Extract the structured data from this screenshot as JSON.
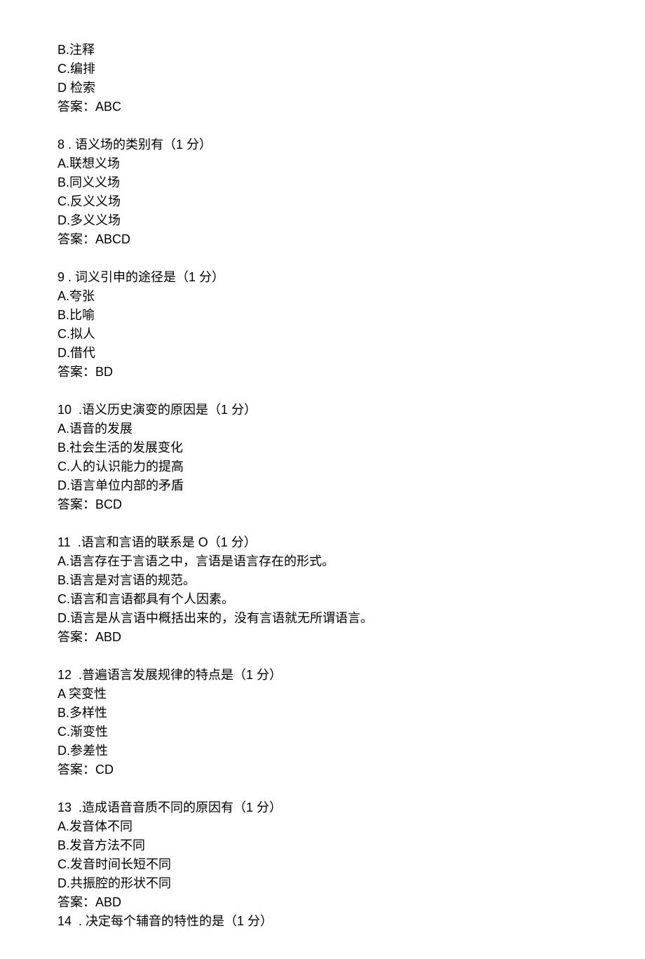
{
  "initial_options": [
    "B.注释",
    "C.编排",
    "D 检索"
  ],
  "initial_answer": "答案：ABC",
  "questions": [
    {
      "number": "8",
      "stem": " . 语义场的类别有（1 分）",
      "options": [
        "A.联想义场",
        "B.同义义场",
        "C.反义义场",
        "D.多义义场"
      ],
      "answer": "答案：ABCD"
    },
    {
      "number": "9",
      "stem": " . 词义引申的途径是（1 分）",
      "options": [
        "A.夸张",
        "B.比喻",
        "C.拟人",
        "D.借代"
      ],
      "answer": "答案：BD"
    },
    {
      "number": "10",
      "stem": "  .语义历史演变的原因是（1 分）",
      "options": [
        "A.语音的发展",
        "B.社会生活的发展变化",
        "C.人的认识能力的提高",
        "D.语言单位内部的矛盾"
      ],
      "answer": "答案：BCD"
    },
    {
      "number": "11",
      "stem": "  .语言和言语的联系是 O（1 分）",
      "options": [
        "A.语言存在于言语之中，言语是语言存在的形式。",
        "B.语言是对言语的规范。",
        "C.语言和言语都具有个人因素。",
        "D.语言是从言语中概括出来的，没有言语就无所谓语言。"
      ],
      "answer": "答案：ABD"
    },
    {
      "number": "12",
      "stem": "  .普遍语言发展规律的特点是（1 分）",
      "options": [
        "A 突变性",
        "B.多样性",
        "C.渐变性",
        "D.参差性"
      ],
      "answer": "答案：CD"
    },
    {
      "number": "13",
      "stem": "  .造成语音音质不同的原因有（1 分）",
      "options": [
        "A.发音体不同",
        "B.发音方法不同",
        "C.发音时间长短不同",
        "D.共振腔的形状不同"
      ],
      "answer": "答案：ABD"
    }
  ],
  "trailing_question": {
    "number": "14",
    "stem": "  . 决定每个辅音的特性的是（1 分）"
  }
}
